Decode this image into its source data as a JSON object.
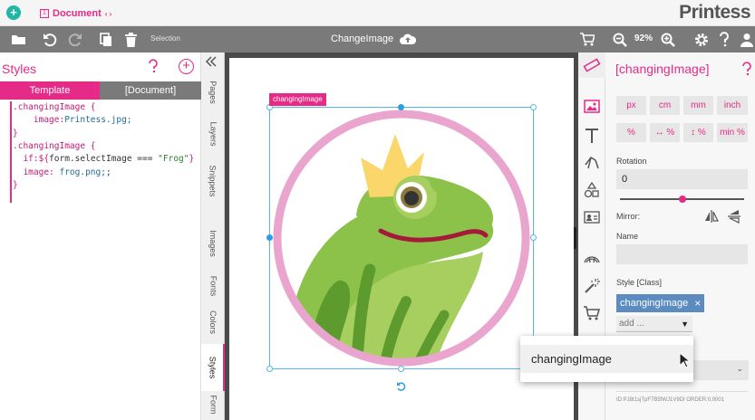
{
  "app": {
    "brand": "Printess"
  },
  "topbar": {
    "doc_number": "1",
    "doc_tab_label": "Document",
    "doc_tab_arrows": "‹ ›",
    "add_label": "+"
  },
  "toolbar": {
    "selection_label": "Selection",
    "document_title": "ChangeImage",
    "zoom": "92%"
  },
  "styles_panel": {
    "title": "Styles",
    "add_label": "+",
    "tabs": [
      {
        "label": "Template"
      },
      {
        "label": "[Document]"
      }
    ],
    "code": [
      [
        {
          "t": ".changingImage {",
          "c": "c-sel"
        }
      ],
      [
        {
          "t": "    image:",
          "c": "c-prop"
        },
        {
          "t": "Printess.jpg;",
          "c": "c-val"
        }
      ],
      [
        {
          "t": "}",
          "c": "c-sel"
        }
      ],
      [
        {
          "t": ".changingImage {",
          "c": "c-sel"
        }
      ],
      [
        {
          "t": "  if:",
          "c": "c-kw"
        },
        {
          "t": "${",
          "c": "c-kw"
        },
        {
          "t": "form.selectImage === ",
          "c": "c-plain"
        },
        {
          "t": "\"Frog\"",
          "c": "c-str"
        },
        {
          "t": "}",
          "c": "c-kw"
        }
      ],
      [
        {
          "t": "  image: ",
          "c": "c-prop"
        },
        {
          "t": "frog.png;",
          "c": "c-val"
        },
        {
          "t": ";",
          "c": "c-plain"
        }
      ],
      [
        {
          "t": "}",
          "c": "c-sel"
        }
      ]
    ]
  },
  "vtabs": [
    "Pages",
    "Layers",
    "Snippets",
    "Images",
    "Fonts",
    "Colors",
    "Styles",
    "Form"
  ],
  "canvas": {
    "selection_label": "changingImage"
  },
  "props": {
    "title": "[changingImage]",
    "unit_buttons_row1": [
      "px",
      "cm",
      "mm",
      "inch"
    ],
    "unit_buttons_row2": [
      "%",
      "↔ %",
      "↕ %",
      "min %"
    ],
    "rotation_label": "Rotation",
    "rotation_value": "0",
    "rotation_fraction": 0.5,
    "mirror_label": "Mirror:",
    "name_label": "Name",
    "name_value": "",
    "style_class_label": "Style [Class]",
    "class_chip": "changingImage",
    "class_chip_remove": "×",
    "add_placeholder": "add ...",
    "id_line": "ID:PJ8t1sjTpF7B5fWJ1V9DI ORDER:0,0001"
  },
  "popover": {
    "item": "changingImage"
  },
  "colors": {
    "accent": "#e62a87",
    "toolbar": "#7a7a7a",
    "chip": "#5b8bbf",
    "selection": "#56b7e6",
    "add_button": "#20b7a4"
  },
  "icons": [
    "folder-icon",
    "undo-icon",
    "redo-icon",
    "copy-icon",
    "trash-icon",
    "cloud-upload-icon",
    "cart-icon",
    "zoom-out-icon",
    "zoom-in-icon",
    "gear-icon",
    "help-icon",
    "user-icon",
    "ruler-icon",
    "image-icon",
    "text-icon",
    "pen-icon",
    "shapes-icon",
    "contact-card-icon",
    "frame-icon",
    "magic-wand-icon"
  ]
}
